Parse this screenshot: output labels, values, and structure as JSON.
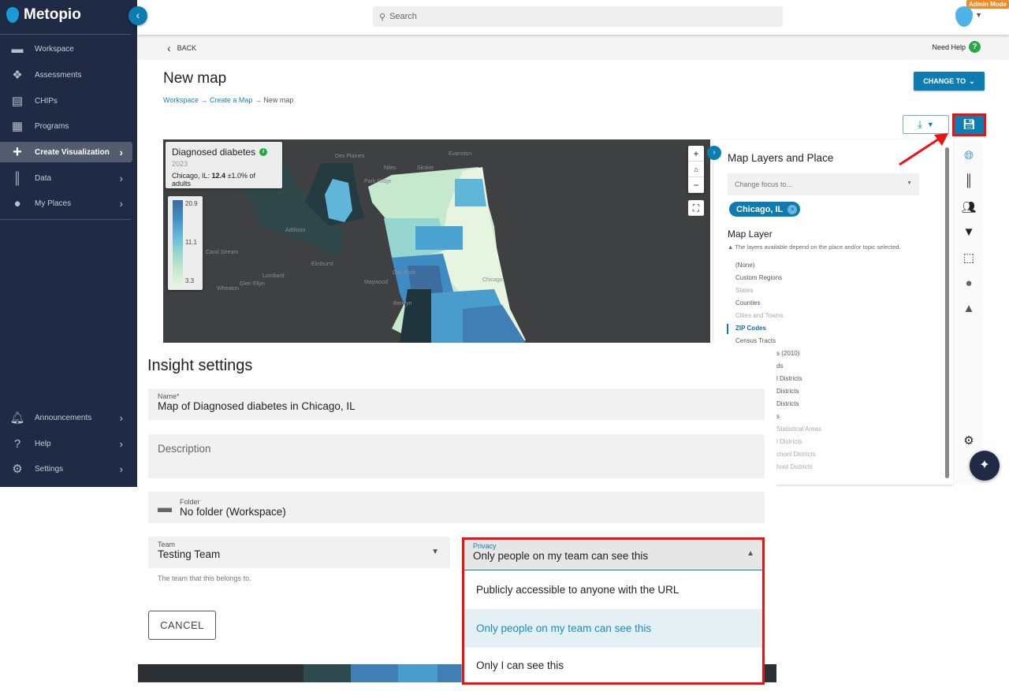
{
  "app": {
    "name": "Metopio",
    "admin_badge": "Admin Mode"
  },
  "sidebar": {
    "items": [
      {
        "label": "Workspace",
        "icon": "folder-icon"
      },
      {
        "label": "Assessments",
        "icon": "assessment-icon"
      },
      {
        "label": "CHIPs",
        "icon": "clipboard-icon"
      },
      {
        "label": "Programs",
        "icon": "programs-icon"
      },
      {
        "label": "Create Visualization",
        "icon": "plus-icon",
        "active": true
      },
      {
        "label": "Data",
        "icon": "books-icon"
      },
      {
        "label": "My Places",
        "icon": "pin-icon"
      }
    ],
    "bottom_items": [
      {
        "label": "Announcements",
        "icon": "bell-icon"
      },
      {
        "label": "Help",
        "icon": "help-icon"
      },
      {
        "label": "Settings",
        "icon": "gear-icon"
      }
    ]
  },
  "topbar": {
    "search_placeholder": "Search"
  },
  "backbar": {
    "back": "BACK",
    "help": "Need Help"
  },
  "page": {
    "title": "New map",
    "breadcrumb": [
      "Workspace",
      "Create a Map",
      "New map"
    ],
    "change_to": "CHANGE TO"
  },
  "map": {
    "indicator": "Diagnosed diabetes",
    "year": "2023",
    "summary_prefix": "Chicago, IL: ",
    "summary_value": "12.4",
    "summary_suffix": " ±1.0% of adults",
    "legend": {
      "max": "20.9",
      "mid": "11.1",
      "min": "3.3"
    },
    "place_labels": [
      "Des Plaines",
      "Evanston",
      "Skokie",
      "Niles",
      "Park Ridge",
      "Addison",
      "Elmhurst",
      "Oak Park",
      "Maywood",
      "Lombard",
      "Glen Ellyn",
      "Wheaton",
      "Berwyn",
      "Chicago",
      "Carol Stream"
    ]
  },
  "panel": {
    "title": "Map Layers and Place",
    "focus_placeholder": "Change focus to...",
    "place_chip": "Chicago, IL",
    "map_layer_heading": "Map Layer",
    "note": "The layers available depend on the place and/or topic selected.",
    "layers": [
      {
        "label": "(None)"
      },
      {
        "label": "Custom Regions"
      },
      {
        "label": "States",
        "dim": true
      },
      {
        "label": "Counties"
      },
      {
        "label": "Cities and Towns",
        "dim": true
      },
      {
        "label": "ZIP Codes",
        "selected": true
      },
      {
        "label": "Census Tracts"
      }
    ],
    "layers_partial": [
      "s (2010)",
      "ds",
      "l Districts",
      "Districts",
      "Districts",
      "s",
      "Statistical Areas",
      "l Districts",
      "chool Districts",
      "hool Districts"
    ]
  },
  "settings": {
    "heading": "Insight settings",
    "name_label": "Name*",
    "name_value": "Map of Diagnosed diabetes in Chicago, IL",
    "description_placeholder": "Description",
    "folder_label": "Folder",
    "folder_value": "No folder (Workspace)",
    "team_label": "Team",
    "team_value": "Testing Team",
    "team_help": "The team that this belongs to.",
    "privacy_label": "Privacy",
    "privacy_value": "Only people on my team can see this",
    "privacy_options": [
      "Publicly accessible to anyone with the URL",
      "Only people on my team can see this",
      "Only I can see this"
    ],
    "cancel": "CANCEL"
  },
  "colors": {
    "sidebar": "#1f2a44",
    "accent": "#0d7cb0",
    "highlight": "#e11111"
  }
}
